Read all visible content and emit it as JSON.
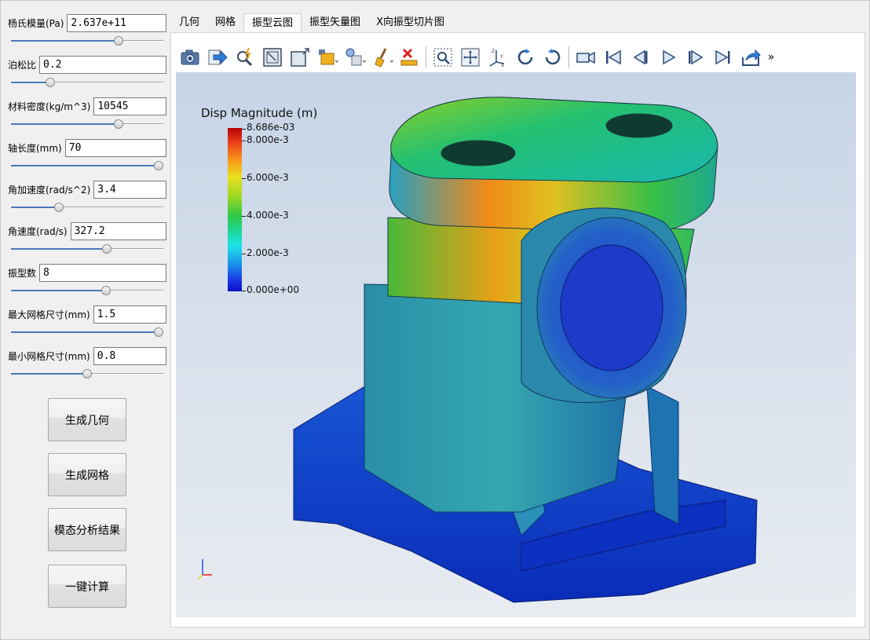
{
  "params": [
    {
      "label": "杨氏模量(Pa)",
      "value": "2.637e+11",
      "slider_pos": 0.72
    },
    {
      "label": "泊松比",
      "value": "0.2",
      "slider_pos": 0.24
    },
    {
      "label": "材料密度(kg/m^3)",
      "value": "10545",
      "slider_pos": 0.72
    },
    {
      "label": "轴长度(mm)",
      "value": "70",
      "slider_pos": 1.0
    },
    {
      "label": "角加速度(rad/s^2)",
      "value": "3.4",
      "slider_pos": 0.3
    },
    {
      "label": "角速度(rad/s)",
      "value": "327.2",
      "slider_pos": 0.64
    },
    {
      "label": "振型数",
      "value": "8",
      "slider_pos": 0.63
    },
    {
      "label": "最大网格尺寸(mm)",
      "value": "1.5",
      "slider_pos": 1.0
    },
    {
      "label": "最小网格尺寸(mm)",
      "value": "0.8",
      "slider_pos": 0.5
    }
  ],
  "buttons": {
    "generate_geometry": "生成几何",
    "generate_mesh": "生成网格",
    "modal_results": "模态分析结果",
    "one_click_compute": "一键计算"
  },
  "tabs": [
    {
      "label": "几何",
      "active": false
    },
    {
      "label": "网格",
      "active": false
    },
    {
      "label": "振型云图",
      "active": true
    },
    {
      "label": "振型矢量图",
      "active": false
    },
    {
      "label": "X向振型切片图",
      "active": false
    }
  ],
  "toolbar": {
    "icons": [
      "camera-icon",
      "export-arrow-icon",
      "probe-icon",
      "fit-view-icon",
      "zoom-box-icon",
      "display-style-icon",
      "lighting-icon",
      "clear-icon",
      "ruler-icon",
      "zoom-area-icon",
      "pan-icon",
      "axes-orientation-icon",
      "rotate-cw-icon",
      "rotate-ccw-icon",
      "video-camera-icon",
      "first-frame-icon",
      "step-back-icon",
      "play-icon",
      "step-forward-icon",
      "last-frame-icon",
      "share-export-icon"
    ],
    "more": "»"
  },
  "legend": {
    "title": "Disp Magnitude (m)",
    "ticks": [
      "8.686e-03",
      "8.000e-3",
      "6.000e-3",
      "4.000e-3",
      "2.000e-3",
      "0.000e+00"
    ],
    "colors": {
      "max": "#b40000",
      "high": "#f89a1a",
      "mid": "#2cc845",
      "low_mid": "#1ee4e8",
      "min": "#1010c8"
    }
  }
}
